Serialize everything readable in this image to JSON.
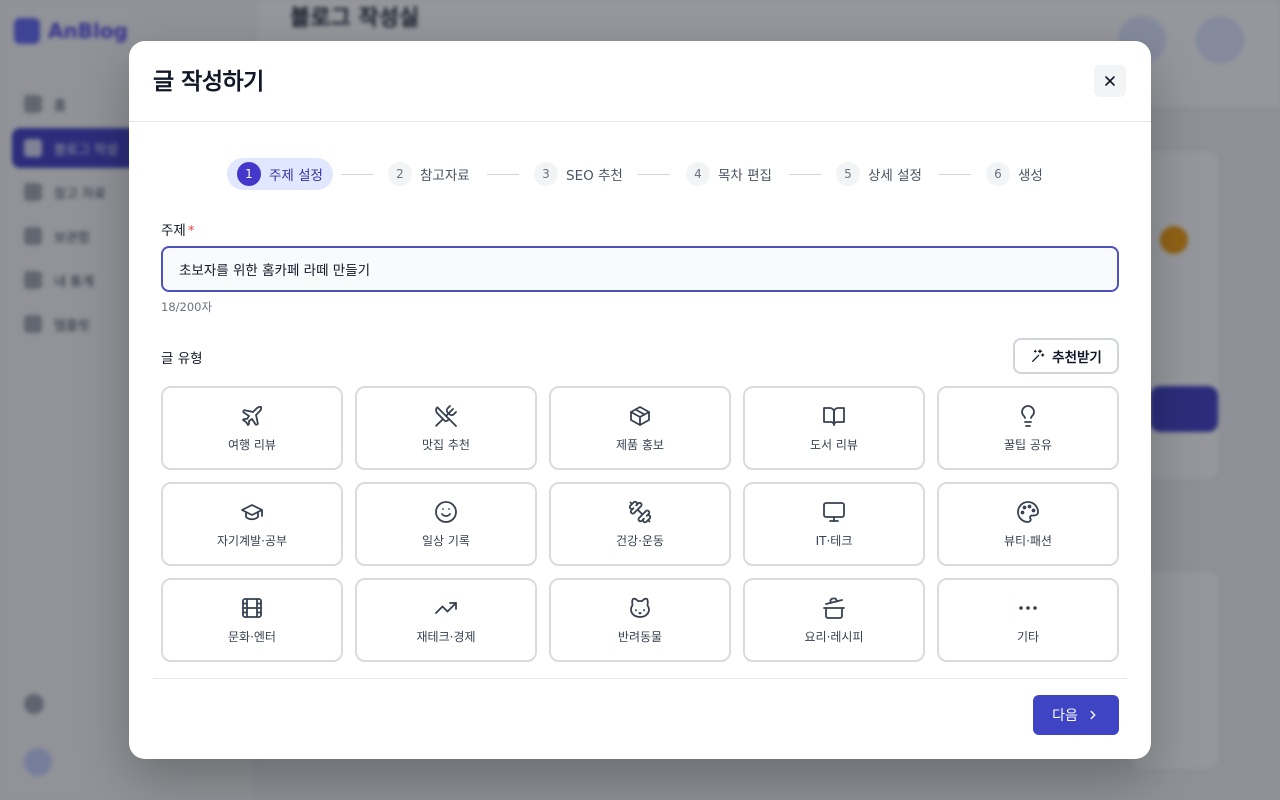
{
  "background": {
    "app_name": "AnBlog",
    "page_title": "블로그 작성실",
    "nav_items": [
      "홈",
      "블로그 작성",
      "참고 자료",
      "보관함",
      "내 통계",
      "템플릿"
    ]
  },
  "modal": {
    "title": "글 작성하기",
    "steps": [
      {
        "num": "1",
        "label": "주제 설정"
      },
      {
        "num": "2",
        "label": "참고자료"
      },
      {
        "num": "3",
        "label": "SEO 추천"
      },
      {
        "num": "4",
        "label": "목차 편집"
      },
      {
        "num": "5",
        "label": "상세 설정"
      },
      {
        "num": "6",
        "label": "생성"
      }
    ],
    "topic": {
      "label": "주제",
      "required_mark": "*",
      "value": "초보자를 위한 홈카페 라떼 만들기",
      "char_count": "18/200자"
    },
    "post_type": {
      "label": "글 유형",
      "recommend_label": "추천받기",
      "types": [
        {
          "label": "여행 리뷰",
          "icon": "plane-icon"
        },
        {
          "label": "맛집 추천",
          "icon": "utensils-icon"
        },
        {
          "label": "제품 홍보",
          "icon": "box-icon"
        },
        {
          "label": "도서 리뷰",
          "icon": "book-icon"
        },
        {
          "label": "꿀팁 공유",
          "icon": "lightbulb-icon"
        },
        {
          "label": "자기계발·공부",
          "icon": "graduation-cap-icon"
        },
        {
          "label": "일상 기록",
          "icon": "smile-icon"
        },
        {
          "label": "건강·운동",
          "icon": "dumbbell-icon"
        },
        {
          "label": "IT·테크",
          "icon": "monitor-icon"
        },
        {
          "label": "뷰티·패션",
          "icon": "palette-icon"
        },
        {
          "label": "문화·엔터",
          "icon": "film-icon"
        },
        {
          "label": "재테크·경제",
          "icon": "trending-up-icon"
        },
        {
          "label": "반려동물",
          "icon": "cat-icon"
        },
        {
          "label": "요리·레시피",
          "icon": "cooking-pot-icon"
        },
        {
          "label": "기타",
          "icon": "more-icon"
        }
      ]
    },
    "next_label": "다음"
  }
}
